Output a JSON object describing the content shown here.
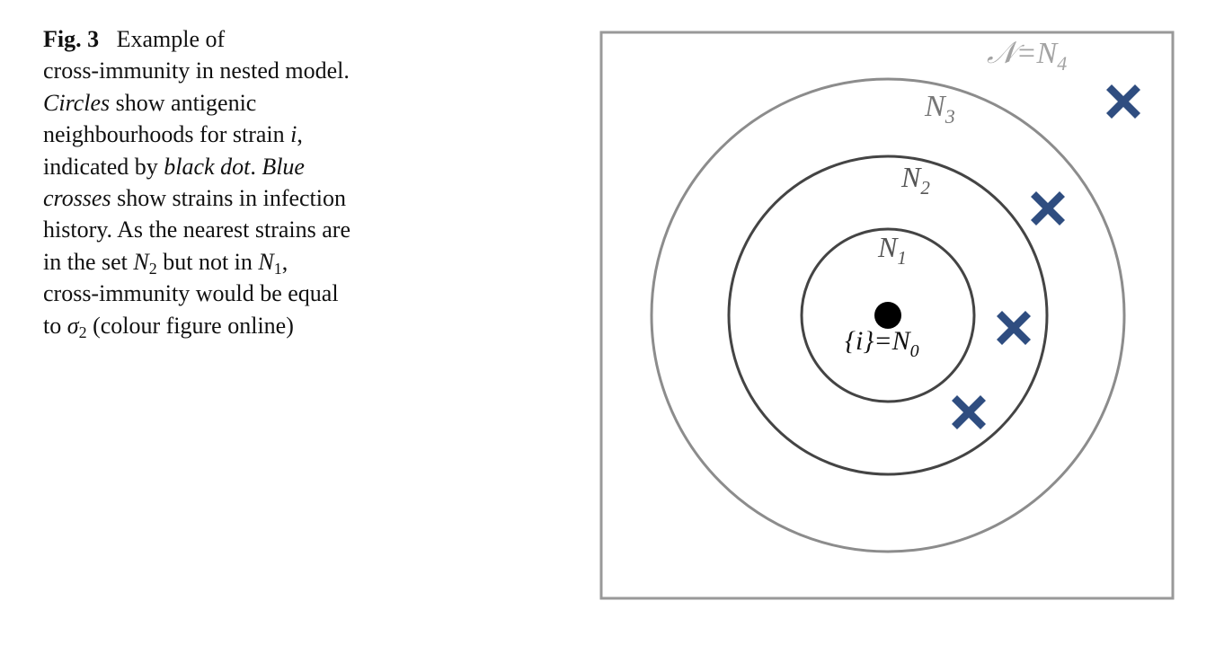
{
  "caption": {
    "fig_label": "Fig. 3",
    "l1": "Example of",
    "l2": "cross-immunity in nested model.",
    "l3_italic": "Circles",
    "l3_rest": " show antigenic",
    "l4_text": "neighbourhoods for strain ",
    "l4_italic": "i",
    "l4_tail": ",",
    "l5_text": "indicated by ",
    "l5_italic1": "black dot",
    "l5_mid": ". ",
    "l5_italic2": "Blue",
    "l6_italic": "crosses",
    "l6_rest": " show strains in infection",
    "l7": "history. As the nearest strains are",
    "l8_a": "in the set ",
    "l8_n": "N",
    "l8_sub": "2",
    "l8_b": " but not in ",
    "l8_n2": "N",
    "l8_sub2": "1",
    "l8_tail": ",",
    "l9": "cross-immunity would be equal",
    "l10_a": "to ",
    "l10_sigma": "σ",
    "l10_sub": "2",
    "l10_rest": " (colour figure online)"
  },
  "figure": {
    "outer_label_script": "𝒩",
    "outer_label_eq": "=N",
    "outer_label_sub": "4",
    "n3_label": "N",
    "n3_sub": "3",
    "n2_label": "N",
    "n2_sub": "2",
    "n1_label": "N",
    "n1_sub": "1",
    "n0_label": "{i}=N",
    "n0_sub": "0",
    "colors": {
      "box": "#999999",
      "circle_outer": "#8c8c8c",
      "circle_inner": "#444444",
      "cross": "#2f4d80",
      "dot": "#000000"
    }
  }
}
